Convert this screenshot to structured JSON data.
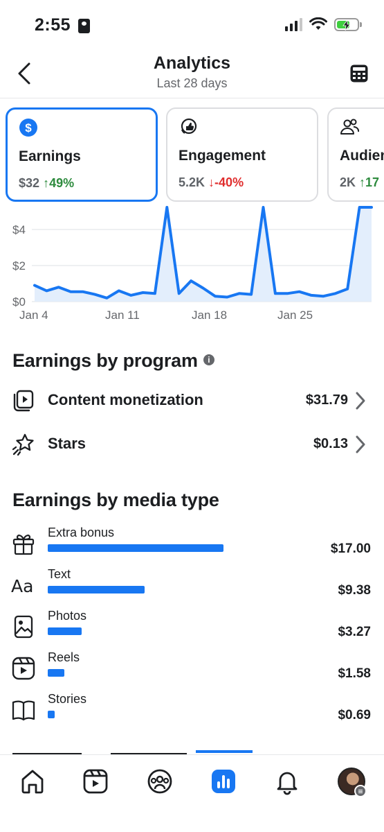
{
  "status_bar": {
    "time": "2:55"
  },
  "header": {
    "title": "Analytics",
    "subtitle": "Last 28 days"
  },
  "metrics": [
    {
      "label": "Earnings",
      "value": "$32",
      "change": "↑49%",
      "direction": "up",
      "active": true,
      "icon": "dollar-circle-icon"
    },
    {
      "label": "Engagement",
      "value": "5.2K",
      "change": "↓-40%",
      "direction": "down",
      "active": false,
      "icon": "thumbs-up-icon"
    },
    {
      "label": "Audien",
      "value": "2K",
      "change": "↑17",
      "direction": "up",
      "active": false,
      "icon": "people-icon"
    }
  ],
  "chart_data": {
    "type": "line",
    "x": [
      1,
      2,
      3,
      4,
      5,
      6,
      7,
      8,
      9,
      10,
      11,
      12,
      13,
      14,
      15,
      16,
      17,
      18,
      19,
      20,
      21,
      22,
      23,
      24,
      25,
      26,
      27,
      28,
      29
    ],
    "values": [
      0.9,
      0.6,
      0.8,
      0.55,
      0.55,
      0.4,
      0.2,
      0.6,
      0.35,
      0.5,
      0.45,
      6.5,
      0.45,
      1.15,
      0.75,
      0.3,
      0.25,
      0.45,
      0.4,
      6.5,
      0.45,
      0.45,
      0.55,
      0.35,
      0.3,
      0.45,
      0.7,
      6.5,
      6.5
    ],
    "x_ticks": [
      "Jan 4",
      "Jan 11",
      "Jan 18",
      "Jan 25"
    ],
    "y_ticks": [
      "$0",
      "$2",
      "$4"
    ],
    "ylim": [
      0,
      4.8
    ],
    "grid": true,
    "color": "#1877f2"
  },
  "earnings_by_program": {
    "title": "Earnings by program",
    "info_glyph": "i",
    "items": [
      {
        "label": "Content monetization",
        "value": "$31.79",
        "icon": "content-monetization-icon"
      },
      {
        "label": "Stars",
        "value": "$0.13",
        "icon": "stars-icon"
      }
    ]
  },
  "earnings_by_media": {
    "title": "Earnings by media type",
    "items": [
      {
        "label": "Extra bonus",
        "value": "$17.00",
        "amount": 17.0,
        "icon": "gift-icon"
      },
      {
        "label": "Text",
        "value": "$9.38",
        "amount": 9.38,
        "icon": "text-icon"
      },
      {
        "label": "Photos",
        "value": "$3.27",
        "amount": 3.27,
        "icon": "photo-icon"
      },
      {
        "label": "Reels",
        "value": "$1.58",
        "amount": 1.58,
        "icon": "reels-icon"
      },
      {
        "label": "Stories",
        "value": "$0.69",
        "amount": 0.69,
        "icon": "book-icon"
      }
    ]
  },
  "bottom_nav": [
    "home-icon",
    "reels-icon",
    "groups-icon",
    "analytics-icon",
    "notifications-icon",
    "profile-avatar"
  ],
  "colors": {
    "accent": "#1877f2",
    "positive": "#2e8b3e",
    "negative": "#e02d2d"
  }
}
